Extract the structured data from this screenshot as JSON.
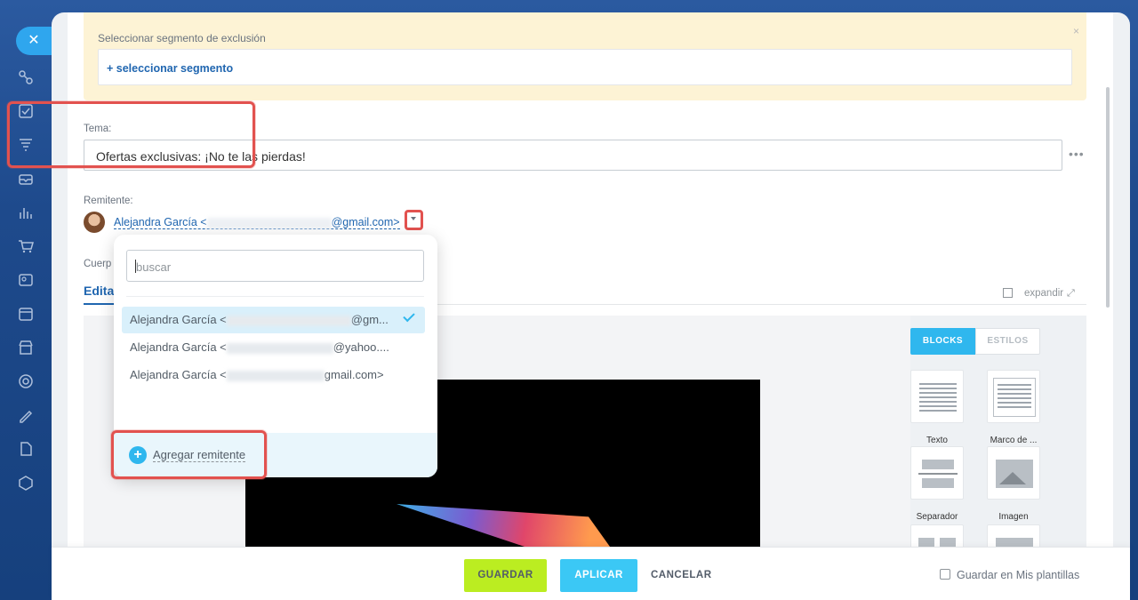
{
  "exclusion": {
    "title": "Seleccionar segmento de exclusión",
    "close": "×",
    "link": "+ seleccionar segmento"
  },
  "tema": {
    "label": "Tema:",
    "value": "Ofertas exclusivas: ¡No te las pierdas!",
    "more": "•••"
  },
  "remitente": {
    "label": "Remitente:",
    "name_prefix": "Alejandra García <",
    "name_suffix": "@gmail.com>"
  },
  "body": {
    "cuerpo_label": "Cuerp",
    "editor_tab": "Edita",
    "expand": "expandir"
  },
  "side_panel": {
    "tab_blocks": "BLOCKS",
    "tab_styles": "ESTILOS",
    "blocks": [
      {
        "label": "Texto"
      },
      {
        "label": "Marco de ..."
      },
      {
        "label": "Separador"
      },
      {
        "label": "Imagen"
      }
    ]
  },
  "sender_dropdown": {
    "search_placeholder": "buscar",
    "items": [
      {
        "prefix": "Alejandra García <",
        "suffix": "@gm...",
        "selected": true
      },
      {
        "prefix": "Alejandra García <",
        "suffix": "@yahoo....",
        "selected": false
      },
      {
        "prefix": "Alejandra García <",
        "suffix": "gmail.com>",
        "selected": false
      }
    ],
    "add_label": "Agregar remitente"
  },
  "footer": {
    "save": "GUARDAR",
    "apply": "APLICAR",
    "cancel": "CANCELAR",
    "save_template": "Guardar en Mis plantillas"
  },
  "colors": {
    "accent_blue": "#2fb7ee",
    "link_blue": "#2066b0",
    "save_green": "#bbed21",
    "highlight_red": "#e2524f",
    "exclusion_bg": "#fdf3d5"
  }
}
